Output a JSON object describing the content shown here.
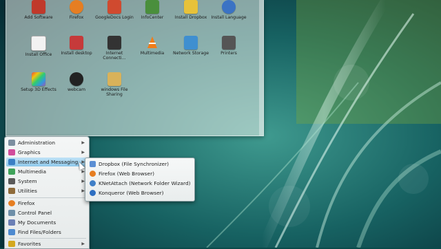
{
  "desktop_panel": {
    "icons": [
      {
        "label": "Add Software",
        "icon": "package-icon",
        "color": "#c0392b"
      },
      {
        "label": "Firefox",
        "icon": "firefox-icon",
        "color": "#e67e22"
      },
      {
        "label": "GoogleDocs Login",
        "icon": "google-docs-icon",
        "color": "#d04a2f"
      },
      {
        "label": "InfoCenter",
        "icon": "info-center-icon",
        "color": "#4a8f3c"
      },
      {
        "label": "Install Dropbox",
        "icon": "dropbox-icon",
        "color": "#e7c23a"
      },
      {
        "label": "Install Language",
        "icon": "language-icon",
        "color": "#3b73c4"
      },
      {
        "label": "Install Office",
        "icon": "office-doc-icon",
        "color": "#f2f2f2"
      },
      {
        "label": "Install desktop",
        "icon": "desktop-install-icon",
        "color": "#c63a3a"
      },
      {
        "label": "Internet Connecti…",
        "icon": "internet-connection-icon",
        "color": "#333333"
      },
      {
        "label": "Multimedia",
        "icon": "vlc-icon",
        "color": "#f07d1a"
      },
      {
        "label": "Network Storage",
        "icon": "network-storage-icon",
        "color": "#3f8fd0"
      },
      {
        "label": "Printers",
        "icon": "printer-icon",
        "color": "#555555"
      },
      {
        "label": "Setup 3D Effects",
        "icon": "3d-effects-icon",
        "color": "#b84bd6"
      },
      {
        "label": "webcam",
        "icon": "webcam-icon",
        "color": "#222222"
      },
      {
        "label": "windows File Sharing",
        "icon": "folder-icon",
        "color": "#d9b25a"
      }
    ]
  },
  "menu": {
    "items": [
      {
        "label": "Administration",
        "icon": "administration-icon",
        "color": "#7c8fa0",
        "submenu": true
      },
      {
        "label": "Graphics",
        "icon": "graphics-icon",
        "color": "#d24c9b",
        "submenu": true
      },
      {
        "label": "Internet and Messaging",
        "icon": "internet-icon",
        "color": "#3a7fc4",
        "submenu": true,
        "active": true
      },
      {
        "label": "Multimedia",
        "icon": "multimedia-icon",
        "color": "#3fa35a",
        "submenu": true
      },
      {
        "label": "System",
        "icon": "system-icon",
        "color": "#5a5a5a",
        "submenu": true
      },
      {
        "label": "Utilities",
        "icon": "utilities-icon",
        "color": "#8f6b3a",
        "submenu": true
      },
      {
        "label": "Firefox",
        "icon": "firefox-icon",
        "color": "#e67e22",
        "submenu": false
      },
      {
        "label": "Control Panel",
        "icon": "control-panel-icon",
        "color": "#6e8fa8",
        "submenu": false
      },
      {
        "label": "My Documents",
        "icon": "documents-icon",
        "color": "#6a7fb5",
        "submenu": false
      },
      {
        "label": "Find Files/Folders",
        "icon": "find-icon",
        "color": "#4d8ad0",
        "submenu": false
      },
      {
        "label": "Favorites",
        "icon": "favorites-icon",
        "color": "#d4a81f",
        "submenu": true
      }
    ]
  },
  "submenu": {
    "items": [
      {
        "label": "Dropbox (File Synchronizer)",
        "icon": "dropbox-icon",
        "color": "#5b8fd4"
      },
      {
        "label": "Firefox (Web Browser)",
        "icon": "firefox-icon",
        "color": "#e67e22"
      },
      {
        "label": "KNetAttach (Network Folder Wizard)",
        "icon": "knetattach-icon",
        "color": "#3f7fc7"
      },
      {
        "label": "Konqueror (Web Browser)",
        "icon": "konqueror-icon",
        "color": "#2e6fc1"
      }
    ]
  }
}
